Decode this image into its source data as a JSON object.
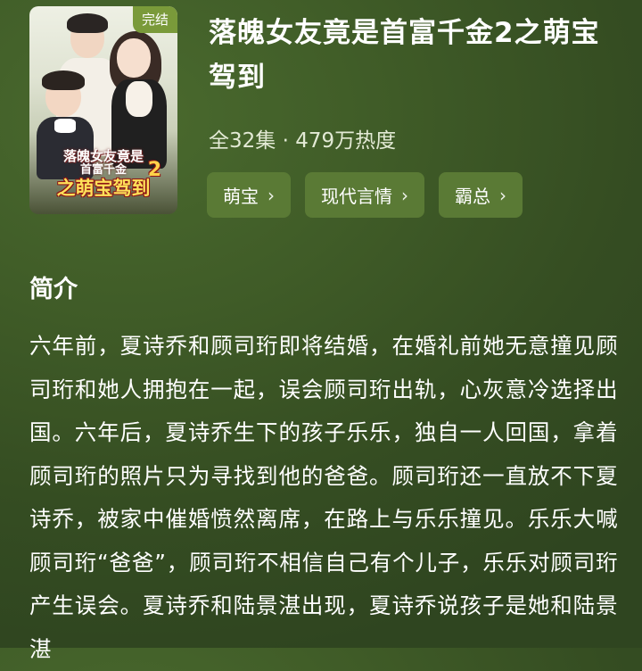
{
  "cover": {
    "badge": "完结",
    "art_line1": "落魄女友竟是",
    "art_line2": "首富千金",
    "art_line3": "之萌宝驾到",
    "art_number": "2"
  },
  "drama": {
    "title": "落魄女友竟是首富千金2之萌宝驾到",
    "meta": "全32集 · 479万热度",
    "tags": [
      {
        "label": "萌宝",
        "chevron": "›"
      },
      {
        "label": "现代言情",
        "chevron": "›"
      },
      {
        "label": "霸总",
        "chevron": "›"
      }
    ]
  },
  "synopsis": {
    "heading": "简介",
    "text": "六年前，夏诗乔和顾司珩即将结婚，在婚礼前她无意撞见顾司珩和她人拥抱在一起，误会顾司珩出轨，心灰意冷选择出国。六年后，夏诗乔生下的孩子乐乐，独自一人回国，拿着顾司珩的照片只为寻找到他的爸爸。顾司珩还一直放不下夏诗乔，被家中催婚愤然离席，在路上与乐乐撞见。乐乐大喊顾司珩“爸爸”，顾司珩不相信自己有个儿子，乐乐对顾司珩产生误会。夏诗乔和陆景湛出现，夏诗乔说孩子是她和陆景湛"
  },
  "colors": {
    "background": "#3f5b27",
    "tag_bg": "#5a7a35",
    "badge_bg": "#7a9a3a"
  }
}
